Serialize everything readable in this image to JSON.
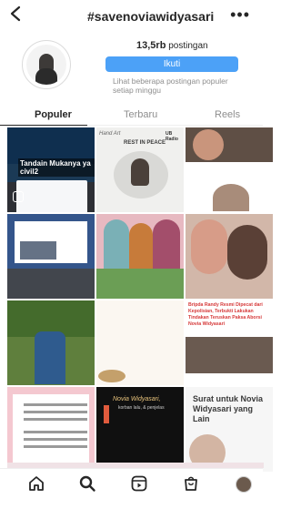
{
  "header": {
    "back_icon": "chevron-left-icon",
    "title": "#savenoviawidyasari",
    "more_icon": "more-horizontal-icon"
  },
  "hashtag": {
    "count_number": "13,5rb",
    "count_label": "postingan",
    "follow_label": "Ikuti",
    "hint": "Lihat beberapa postingan populer setiap minggu"
  },
  "tabs": [
    {
      "label": "Populer",
      "active": true
    },
    {
      "label": "Terbaru",
      "active": false
    },
    {
      "label": "Reels",
      "active": false
    }
  ],
  "posts": {
    "c1_caption": "Tandain Mukanya ya civil2",
    "c2_head": "REST IN PEACE",
    "c2_logo_left": "Hand Art",
    "c2_logo_right": "UB Radio",
    "c9_headline": "Bripda Randy Resmi Dipecat dari Kepolisian, Terbukti Lakukan Tindakan Teruskan Paksa Aborsi Novia Widyasari",
    "c11_title": "Novia Widyasari,",
    "c11_sub": "korban lalu, & penjelas",
    "c12_title": "Surat untuk Novia Widyasari yang Lain"
  },
  "nav": {
    "home_icon": "home-icon",
    "search_icon": "search-icon",
    "reels_icon": "reels-icon",
    "shop_icon": "shop-icon",
    "profile_icon": "profile-avatar-icon"
  },
  "colors": {
    "follow_button": "#4ca1f7",
    "text_primary": "#262626",
    "text_secondary": "#8e8e8e"
  }
}
